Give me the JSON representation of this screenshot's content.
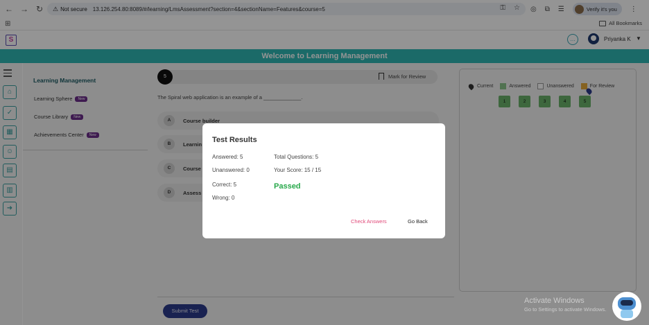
{
  "browser": {
    "not_secure_label": "Not secure",
    "url": "13.126.254.80:8089/#/learning/LmsAssessment?section=4&sectionName=Features&course=5",
    "verify_label": "Verify it's you",
    "all_bookmarks_label": "All Bookmarks"
  },
  "header": {
    "user_name": "Priyanka K",
    "welcome_text": "Welcome to Learning Management"
  },
  "sidebar": {
    "title": "Learning Management",
    "items": [
      {
        "label": "Learning Sphere",
        "badge": "New"
      },
      {
        "label": "Course Library",
        "badge": "New"
      },
      {
        "label": "Achievements Center",
        "badge": "New"
      }
    ]
  },
  "question": {
    "number": "5",
    "mark_for_review_label": "Mark for Review",
    "text": "The Spiral web application is an example of a _____________.",
    "options": [
      {
        "letter": "A",
        "text": "Course builder"
      },
      {
        "letter": "B",
        "text": "Learnin"
      },
      {
        "letter": "C",
        "text": "Course"
      },
      {
        "letter": "D",
        "text": "Assess"
      }
    ],
    "submit_label": "Submit Test"
  },
  "status_panel": {
    "legend": {
      "current": "Current",
      "answered": "Answered",
      "unanswered": "Unanswered",
      "review": "For Review"
    },
    "question_numbers": [
      "1",
      "2",
      "3",
      "4",
      "5"
    ]
  },
  "modal": {
    "title": "Test Results",
    "answered": "Answered: 5",
    "unanswered": "Unanswered: 0",
    "correct": "Correct: 5",
    "wrong": "Wrong: 0",
    "total_questions": "Total Questions: 5",
    "score": "Your Score: 15 / 15",
    "result": "Passed",
    "check_answers_label": "Check Answers",
    "go_back_label": "Go Back"
  },
  "watermark": {
    "line1": "Activate Windows",
    "line2": "Go to Settings to activate Windows."
  },
  "colors": {
    "accent": "#2fb7b3",
    "passed": "#27a84a",
    "check_answers": "#e04878",
    "submit": "#2c3c8c"
  }
}
